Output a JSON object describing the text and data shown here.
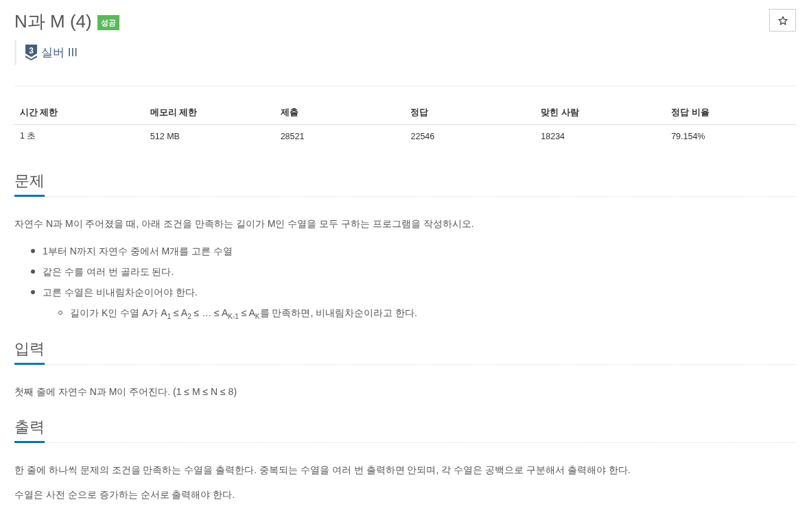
{
  "problem": {
    "title": "N과 M (4)",
    "result_badge": "성공",
    "tier": {
      "number": "3",
      "name": "실버 III"
    }
  },
  "info_table": {
    "columns": [
      "시간 제한",
      "메모리 제한",
      "제출",
      "정답",
      "맞힌 사람",
      "정답 비율"
    ],
    "rows": [
      [
        "1 초",
        "512 MB",
        "28521",
        "22546",
        "18234",
        "79.154%"
      ]
    ]
  },
  "sections": [
    {
      "heading": "문제",
      "blocks": [
        {
          "kind": "paragraph",
          "text": "자연수 N과 M이 주어졌을 때, 아래 조건을 만족하는 길이가 M인 수열을 모두 구하는 프로그램을 작성하시오."
        },
        {
          "kind": "list",
          "items": [
            {
              "text": "1부터 N까지 자연수 중에서 M개를 고른 수열"
            },
            {
              "text": "같은 수를 여러 번 골라도 된다."
            },
            {
              "text": "고른 수열은 비내림차순이어야 한다.",
              "children": [
                {
                  "text": "길이가 K인 수열 A가 A$_{1}$ ≤ A$_{2}$ ≤ … ≤ A$_{K-1}$ ≤ A$_{K}$를 만족하면, 비내림차순이라고 한다."
                }
              ]
            }
          ]
        }
      ]
    },
    {
      "heading": "입력",
      "blocks": [
        {
          "kind": "paragraph",
          "text": "첫째 줄에 자연수 N과 M이 주어진다. (1 ≤ M ≤ N ≤ 8)"
        }
      ]
    },
    {
      "heading": "출력",
      "blocks": [
        {
          "kind": "paragraph",
          "text": "한 줄에 하나씩 문제의 조건을 만족하는 수열을 출력한다. 중복되는 수열을 여러 번 출력하면 안되며, 각 수열은 공백으로 구분해서 출력해야 한다."
        },
        {
          "kind": "paragraph",
          "text": "수열은 사전 순으로 증가하는 순서로 출력해야 한다."
        }
      ]
    }
  ]
}
